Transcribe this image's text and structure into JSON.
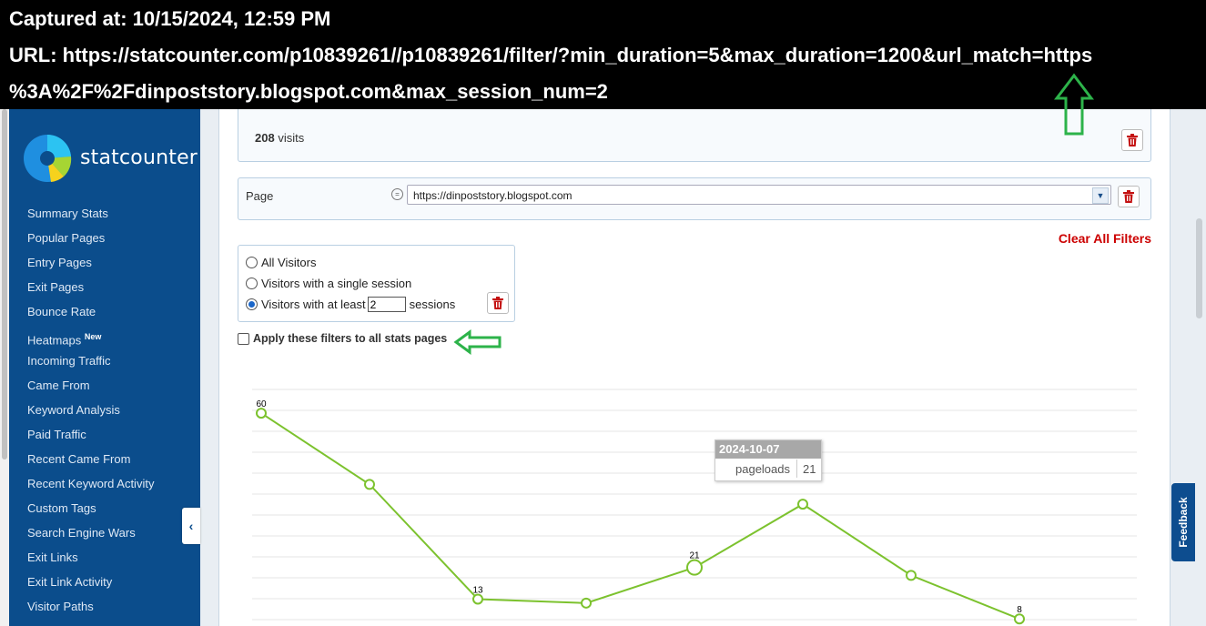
{
  "banner": {
    "captured": "Captured at: 10/15/2024, 12:59 PM",
    "url_line1": "URL: https://statcounter.com/p10839261//p10839261/filter/?min_duration=5&max_duration=1200&url_match=https",
    "url_line2": "%3A%2F%2Fdinpoststory.blogspot.com&max_session_num=2"
  },
  "brand": {
    "name": "statcounter",
    "primary_color": "#0b4d8c"
  },
  "sidebar": {
    "items": [
      {
        "label": "Summary Stats"
      },
      {
        "label": "Popular Pages"
      },
      {
        "label": "Entry Pages"
      },
      {
        "label": "Exit Pages"
      },
      {
        "label": "Bounce Rate"
      },
      {
        "label": "Heatmaps",
        "badge": "New"
      },
      {
        "label": "Incoming Traffic"
      },
      {
        "label": "Came From"
      },
      {
        "label": "Keyword Analysis"
      },
      {
        "label": "Paid Traffic"
      },
      {
        "label": "Recent Came From"
      },
      {
        "label": "Recent Keyword Activity"
      },
      {
        "label": "Custom Tags"
      },
      {
        "label": "Search Engine Wars"
      },
      {
        "label": "Exit Links"
      },
      {
        "label": "Exit Link Activity"
      },
      {
        "label": "Visitor Paths"
      }
    ],
    "collapse_icon": "chevron-left-icon"
  },
  "filters": {
    "visits_count": "208",
    "visits_label": "visits",
    "page_label": "Page",
    "page_operator_icon": "equals-icon",
    "page_value": "https://dinpoststory.blogspot.com",
    "clear_all": "Clear All Filters",
    "visitors": {
      "option_all": "All Visitors",
      "option_single": "Visitors with a single session",
      "option_atleast_prefix": "Visitors with at least",
      "session_value": "2",
      "option_atleast_suffix": "sessions",
      "selected": "atleast"
    },
    "apply_all_label": "Apply these filters to all stats pages",
    "apply_all_checked": false
  },
  "chart_data": {
    "type": "line",
    "series": [
      {
        "values": [
          60,
          42,
          13,
          12,
          21,
          37,
          19,
          8
        ]
      }
    ],
    "data_labels": [
      "60",
      "",
      "13",
      "",
      "21",
      "",
      "",
      "8"
    ],
    "ylim": [
      0,
      66
    ],
    "grid": true,
    "line_color": "#7cc22e"
  },
  "tooltip": {
    "date": "2024-10-07",
    "metric": "pageloads",
    "value": "21"
  },
  "feedback_label": "Feedback"
}
